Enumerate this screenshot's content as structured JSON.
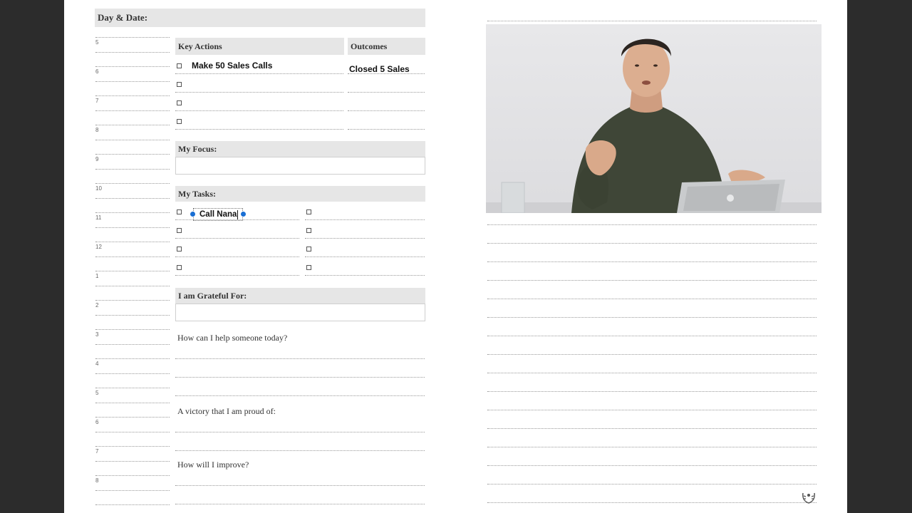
{
  "header": {
    "day_date_label": "Day & Date:"
  },
  "hours": [
    "5",
    "6",
    "7",
    "8",
    "9",
    "10",
    "11",
    "12",
    "1",
    "2",
    "3",
    "4",
    "5",
    "6",
    "7",
    "8"
  ],
  "key_actions": {
    "title": "Key Actions",
    "items": [
      "Make 50 Sales Calls",
      "",
      "",
      ""
    ]
  },
  "outcomes": {
    "title": "Outcomes",
    "items": [
      "Closed 5 Sales",
      "",
      "",
      ""
    ]
  },
  "focus": {
    "title": "My Focus:",
    "value": ""
  },
  "tasks": {
    "title": "My Tasks:",
    "left": [
      "Call Nana",
      "",
      "",
      ""
    ],
    "right": [
      "",
      "",
      "",
      ""
    ]
  },
  "grateful": {
    "title": "I am Grateful For:",
    "value": ""
  },
  "prompts": {
    "help": "How can I help someone today?",
    "victory": "A victory that I am proud of:",
    "improve": "How will I improve?"
  },
  "colors": {
    "selection_handle": "#1a6fd4",
    "header_bar": "#e6e6e6",
    "workspace": "#2c2c2c"
  },
  "icons": {
    "logo": "laurel-icon"
  }
}
